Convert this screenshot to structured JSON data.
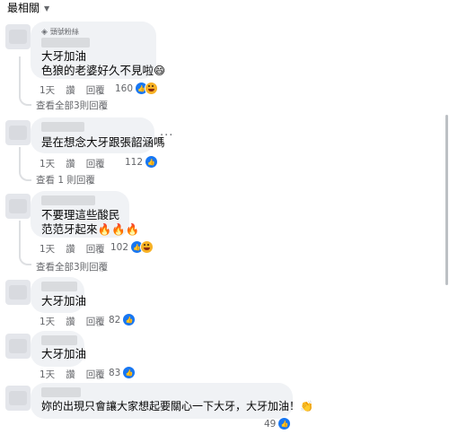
{
  "sort": {
    "label": "最相關"
  },
  "comments": [
    {
      "badge": "頭號粉絲",
      "lines": [
        "大牙加油",
        "色狼的老婆好久不見啦😄"
      ],
      "time": "1天",
      "like": "讚",
      "reply": "回覆",
      "reaction_count": "160",
      "reactions": [
        "like-icon",
        "haha-icon"
      ],
      "replies_link": "查看全部3則回覆"
    },
    {
      "lines": [
        "是在想念大牙跟張韶涵嗎"
      ],
      "time": "1天",
      "like": "讚",
      "reply": "回覆",
      "reaction_count": "112",
      "reactions": [
        "like-icon"
      ],
      "replies_link": "查看 1 則回覆"
    },
    {
      "lines": [
        "不要理這些酸民",
        "范范牙起來🔥🔥🔥"
      ],
      "time": "1天",
      "like": "讚",
      "reply": "回覆",
      "reaction_count": "102",
      "reactions": [
        "like-icon",
        "haha-icon"
      ],
      "replies_link": "查看全部3則回覆"
    },
    {
      "lines": [
        "大牙加油"
      ],
      "time": "1天",
      "like": "讚",
      "reply": "回覆",
      "reaction_count": "82",
      "reactions": [
        "like-icon"
      ]
    },
    {
      "lines": [
        "大牙加油"
      ],
      "time": "1天",
      "like": "讚",
      "reply": "回覆",
      "reaction_count": "83",
      "reactions": [
        "like-icon"
      ]
    },
    {
      "lines": [
        "妳的出現只會讓大家想起要關心一下大牙，大牙加油！👏"
      ],
      "reaction_count": "49",
      "reactions": [
        "like-icon"
      ]
    }
  ],
  "more_options": "···",
  "colors": {
    "bubble": "#f0f2f5",
    "meta": "#65676b",
    "like": "#1877f2",
    "haha": "#f7b125"
  }
}
